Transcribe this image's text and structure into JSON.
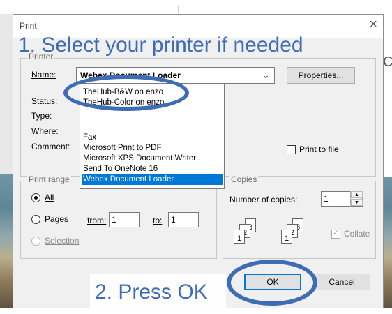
{
  "dialog": {
    "title": "Print",
    "close": "×"
  },
  "annotations": {
    "step1": "1. Select your printer if needed",
    "step2": "2. Press OK"
  },
  "printer_group": {
    "legend": "Printer",
    "name_label": "Name:",
    "selected_printer": "Webex Document Loader",
    "properties_button": "Properties...",
    "status_label": "Status:",
    "type_label": "Type:",
    "where_label": "Where:",
    "comment_label": "Comment:",
    "print_to_file": "Print to file",
    "options": [
      "TheHub-B&W on enzo",
      "TheHub-Color on enzo",
      "Fax",
      "Microsoft Print to PDF",
      "Microsoft XPS Document Writer",
      "Send To OneNote 16",
      "Webex Document Loader"
    ]
  },
  "print_range": {
    "legend": "Print range",
    "all": "All",
    "pages": "Pages",
    "from_label": "from:",
    "from_value": "1",
    "to_label": "to:",
    "to_value": "1",
    "selection": "Selection"
  },
  "copies": {
    "legend": "Copies",
    "number_label": "Number of copies:",
    "value": "1",
    "collate": "Collate",
    "collate_checked": true
  },
  "buttons": {
    "ok": "OK",
    "cancel": "Cancel"
  },
  "colors": {
    "annotation": "#3f6db5",
    "selection": "#0078d7"
  }
}
